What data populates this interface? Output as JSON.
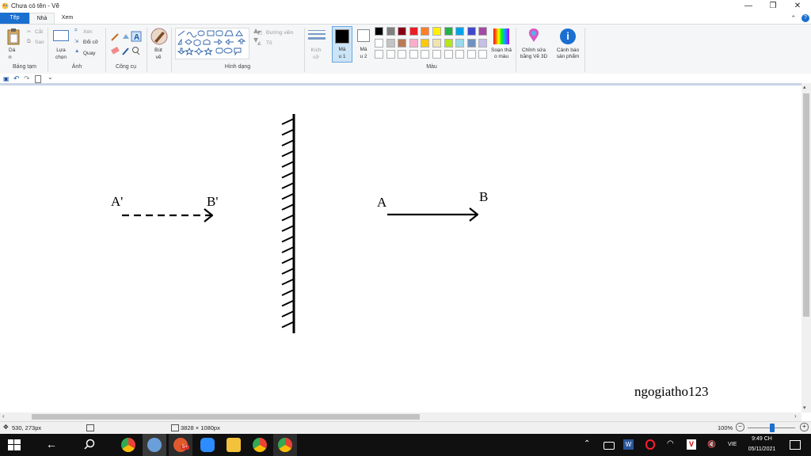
{
  "window": {
    "title": "Chưa có tên - Vẽ",
    "controls": {
      "minimize": "—",
      "maximize": "❐",
      "close": "✕"
    }
  },
  "menu_tabs": [
    {
      "label": "Tệp",
      "active": false
    },
    {
      "label": "Nhà",
      "active": true
    },
    {
      "label": "Xem",
      "active": false
    }
  ],
  "ribbon": {
    "clipboard": {
      "paste": "Dá\nn",
      "cut": "Cắt",
      "copy": "Sao",
      "group_label": "Bảng tạm"
    },
    "image": {
      "select": "Lựa\nchọn",
      "crop": "Xén",
      "resize": "Đổi cỡ",
      "rotate": "Quay",
      "group_label": "Ảnh"
    },
    "tools": {
      "group_label": "Công cụ"
    },
    "brushes": {
      "label": "Bút\nvẽ"
    },
    "shapes": {
      "outline": "Đường viền",
      "fill": "Tô",
      "group_label": "Hình dạng"
    },
    "size": {
      "label": "Kích\ncỡ"
    },
    "color1": {
      "label": "Mà\nu 1",
      "value": "#000000"
    },
    "color2": {
      "label": "Mà\nu 2",
      "value": "#ffffff"
    },
    "colors": {
      "group_label": "Màu",
      "row1": [
        "#000000",
        "#7f7f7f",
        "#880015",
        "#ed1c24",
        "#ff7f27",
        "#fff200",
        "#22b14c",
        "#00a2e8",
        "#3f48cc",
        "#a349a4"
      ],
      "row2": [
        "#ffffff",
        "#c3c3c3",
        "#b97a57",
        "#ffaec9",
        "#ffc90e",
        "#efe4b0",
        "#b5e61d",
        "#99d9ea",
        "#7092be",
        "#c8bfe7"
      ],
      "row3": [
        "#ffffff",
        "#ffffff",
        "#ffffff",
        "#ffffff",
        "#ffffff",
        "#ffffff",
        "#ffffff",
        "#ffffff",
        "#ffffff",
        "#ffffff"
      ]
    },
    "edit_colors": "Soạn thả\no màu",
    "paint3d": "Chỉnh sửa\nbằng Vẽ 3D",
    "product_alert": "Cảnh báo\nsản phẩm"
  },
  "diagram": {
    "label_A": "A",
    "label_B": "B",
    "label_A_prime": "A'",
    "label_B_prime": "B'",
    "signature": "ngogiatho123"
  },
  "statusbar": {
    "cursor_pos": "530, 273px",
    "image_size": "3828 × 1080px",
    "zoom": "100%"
  },
  "taskbar": {
    "language": "VIE",
    "time": "9:49 CH",
    "date": "05/11/2021",
    "mail_badge": "5+"
  }
}
